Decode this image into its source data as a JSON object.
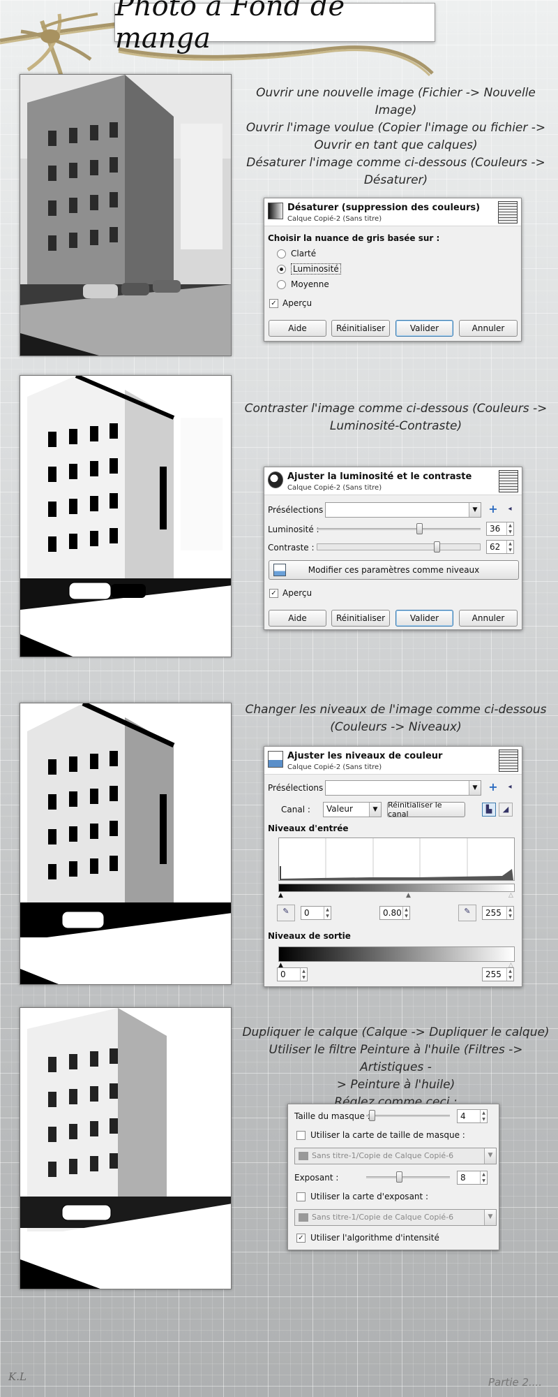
{
  "header": {
    "title": "Photo à Fond de manga"
  },
  "step1": {
    "lines": [
      "Ouvrir une nouvelle image (Fichier -> Nouvelle Image)",
      "Ouvrir l'image voulue (Copier l'image ou fichier ->",
      "Ouvrir en tant que calques)",
      "Désaturer l'image comme ci-dessous (Couleurs ->",
      "Désaturer)"
    ],
    "dialog": {
      "title": "Désaturer (suppression des couleurs)",
      "subtitle": "Calque Copié-2 (Sans titre)",
      "prompt": "Choisir la nuance de gris basée sur :",
      "options": [
        "Clarté",
        "Luminosité",
        "Moyenne"
      ],
      "selected": "Luminosité",
      "preview_label": "Aperçu",
      "preview_checked": true,
      "buttons": [
        "Aide",
        "Réinitialiser",
        "Valider",
        "Annuler"
      ]
    }
  },
  "step2": {
    "lines": [
      "Contraster l'image comme ci-dessous (Couleurs ->",
      "Luminosité-Contraste)"
    ],
    "dialog": {
      "title": "Ajuster la luminosité et le contraste",
      "subtitle": "Calque Copié-2 (Sans titre)",
      "presets_label": "Présélections :",
      "presets_value": "",
      "brightness_label": "Luminosité :",
      "brightness_value": "36",
      "contrast_label": "Contraste :",
      "contrast_value": "62",
      "levels_button": "Modifier ces paramètres comme niveaux",
      "preview_label": "Aperçu",
      "preview_checked": true,
      "buttons": [
        "Aide",
        "Réinitialiser",
        "Valider",
        "Annuler"
      ]
    }
  },
  "step3": {
    "lines": [
      "Changer les niveaux de l'image comme ci-dessous",
      "(Couleurs -> Niveaux)"
    ],
    "dialog": {
      "title": "Ajuster les niveaux de couleur",
      "subtitle": "Calque Copié-2 (Sans titre)",
      "presets_label": "Présélections :",
      "presets_value": "",
      "channel_label": "Canal :",
      "channel_value": "Valeur",
      "reset_channel": "Réinitialiser le canal",
      "input_levels_label": "Niveaux d'entrée",
      "input_low": "0",
      "input_gamma": "0.80",
      "input_high": "255",
      "output_levels_label": "Niveaux de sortie",
      "output_low": "0",
      "output_high": "255"
    }
  },
  "step4": {
    "lines": [
      "Dupliquer le calque (Calque -> Dupliquer le calque)",
      "Utiliser le filtre Peinture à l'huile (Filtres -> Artistiques -",
      "> Peinture à l'huile)",
      "Réglez comme ceci :"
    ],
    "dialog": {
      "mask_size_label": "Taille du masque :",
      "mask_size_value": "4",
      "use_mask_map_label": "Utiliser la carte de taille de masque :",
      "use_mask_map_checked": false,
      "mask_map_value": "Sans titre-1/Copie de Calque Copié-6",
      "exponent_label": "Exposant :",
      "exponent_value": "8",
      "use_exponent_map_label": "Utiliser la carte d'exposant :",
      "use_exponent_map_checked": false,
      "exponent_map_value": "Sans titre-1/Copie de Calque Copié-6",
      "intensity_label": "Utiliser l'algorithme d'intensité",
      "intensity_checked": true
    }
  },
  "footer": {
    "signature": "K.L",
    "next": "Partie 2...."
  }
}
